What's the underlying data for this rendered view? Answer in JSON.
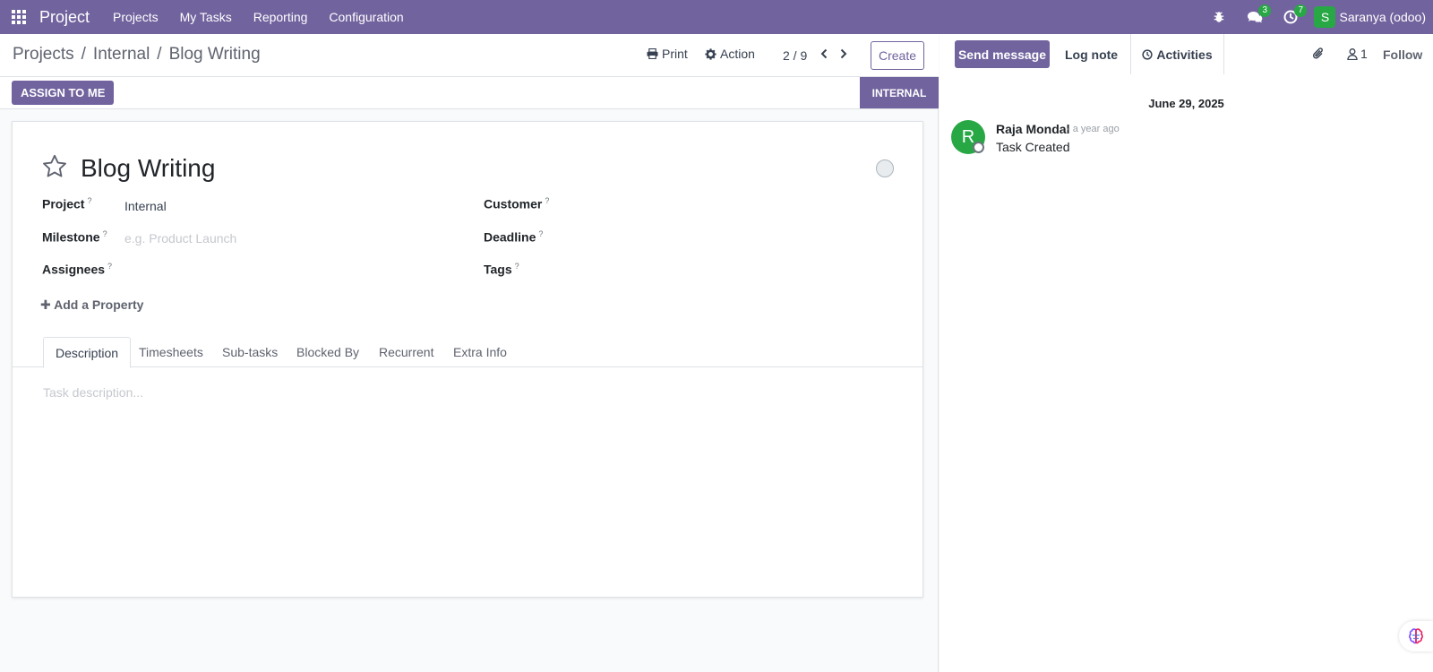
{
  "navbar": {
    "brand": "Project",
    "menu": [
      "Projects",
      "My Tasks",
      "Reporting",
      "Configuration"
    ],
    "messages_count": "3",
    "activities_count": "7",
    "user_initial": "S",
    "user_name": "Saranya (odoo)"
  },
  "control_panel": {
    "breadcrumb": [
      "Projects",
      "Internal",
      "Blog Writing"
    ],
    "print_label": "Print",
    "action_label": "Action",
    "pager": "2 / 9",
    "create_label": "Create"
  },
  "statusbar": {
    "assign_label": "ASSIGN TO ME",
    "stage_label": "INTERNAL"
  },
  "form": {
    "title": "Blog Writing",
    "fields": {
      "project_label": "Project",
      "project_value": "Internal",
      "milestone_label": "Milestone",
      "milestone_placeholder": "e.g. Product Launch",
      "assignees_label": "Assignees",
      "customer_label": "Customer",
      "deadline_label": "Deadline",
      "tags_label": "Tags",
      "help_mark": "?"
    },
    "add_property_label": "Add a Property",
    "tabs": [
      "Description",
      "Timesheets",
      "Sub-tasks",
      "Blocked By",
      "Recurrent",
      "Extra Info"
    ],
    "description_placeholder": "Task description..."
  },
  "chatter": {
    "send_message_label": "Send message",
    "log_note_label": "Log note",
    "activities_label": "Activities",
    "followers_count": "1",
    "follow_label": "Follow",
    "date_separator": "June 29, 2025",
    "message": {
      "author_initial": "R",
      "author": "Raja Mondal",
      "date": "- a year ago",
      "body": "Task Created"
    }
  },
  "colors": {
    "brand": "#71639e",
    "success": "#28a745"
  }
}
